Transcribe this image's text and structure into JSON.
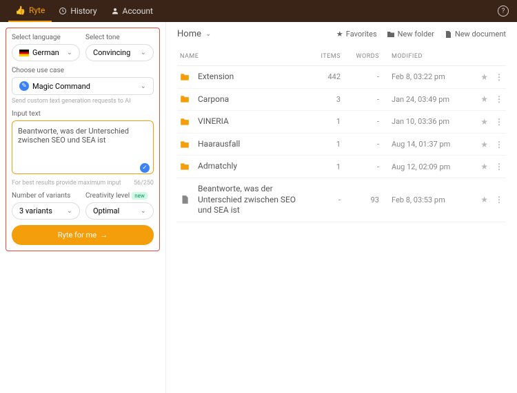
{
  "topnav": {
    "ryte": "Ryte",
    "history": "History",
    "account": "Account"
  },
  "sidebar": {
    "language_label": "Select language",
    "language_value": "German",
    "tone_label": "Select tone",
    "tone_value": "Convincing",
    "usecase_label": "Choose use case",
    "usecase_value": "Magic Command",
    "usecase_hint": "Send custom text generation requests to AI",
    "input_label": "Input text",
    "input_value": "Beantworte, was der Unterschied zwischen SEO und SEA ist",
    "input_hint": "For best results provide maximum input",
    "input_counter": "56/250",
    "variants_label": "Number of variants",
    "variants_value": "3 variants",
    "creativity_label": "Creativity level",
    "creativity_badge": "new",
    "creativity_value": "Optimal",
    "cta": "Ryte for me"
  },
  "content": {
    "breadcrumb": "Home",
    "actions": {
      "favorites": "Favorites",
      "new_folder": "New folder",
      "new_document": "New document"
    },
    "columns": {
      "name": "Name",
      "items": "Items",
      "words": "Words",
      "modified": "Modified"
    },
    "rows": [
      {
        "type": "folder",
        "name": "Extension",
        "items": "442",
        "words": "-",
        "modified": "Feb 8, 03:22 pm"
      },
      {
        "type": "folder",
        "name": "Carpona",
        "items": "3",
        "words": "-",
        "modified": "Jan 24, 03:49 pm"
      },
      {
        "type": "folder",
        "name": "VINERIA",
        "items": "1",
        "words": "-",
        "modified": "Jan 10, 03:36 pm"
      },
      {
        "type": "folder",
        "name": "Haarausfall",
        "items": "1",
        "words": "-",
        "modified": "Aug 14, 01:37 pm"
      },
      {
        "type": "folder",
        "name": "Admatchly",
        "items": "1",
        "words": "-",
        "modified": "Aug 12, 02:09 pm"
      },
      {
        "type": "doc",
        "name": "Beantworte, was der Unterschied zwischen SEO und SEA ist",
        "items": "-",
        "words": "93",
        "modified": "Feb 8, 03:53 pm"
      }
    ]
  }
}
